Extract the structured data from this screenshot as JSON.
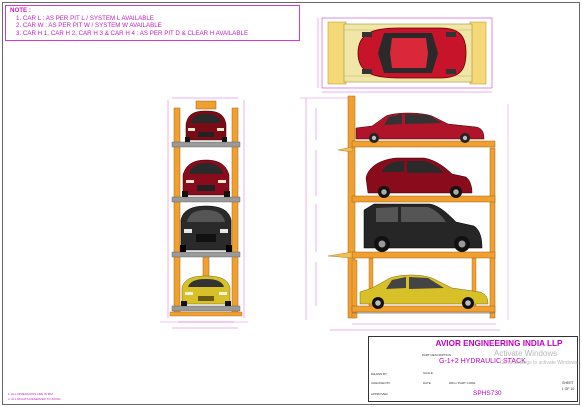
{
  "note": {
    "heading": "NOTE :",
    "lines": [
      "1. CAR L : AS PER PIT L / SYSTEM L AVAILABLE",
      "2. CAR W : AS PER PIT W / SYSTEM W AVAILABLE",
      "3. CAR H 1, CAR H 2, CAR H 3  & CAR H 4 : AS PER PIT D & CLEAR H AVAILABLE"
    ]
  },
  "title_block": {
    "company": "AVIOR ENGINEERING INDIA LLP",
    "logo_text": "AVIOR",
    "part_description_label": "PART DESCRIPTION",
    "part_description": "G-1+2 HYDRAULIC STACK",
    "drg_no_label": "DRG / PART CODE",
    "drg_no": "SPHS730",
    "sheet_label": "SHEET",
    "sheet": "1 OF 10",
    "drawn_by_label": "DRAWN BY",
    "checked_by_label": "CHECKED BY",
    "approved_label": "APPROVED",
    "scale_label": "SCALE",
    "date_label": "DATE"
  },
  "watermark": [
    "Activate Windows",
    "Go to Settings to activate Windows."
  ],
  "footnotes": [
    "1. ALL DIMENSIONS ARE IN MM",
    "2. ALL RIGHTS RESERVED TO AVIOR"
  ],
  "colors": {
    "frame": "#f0a030",
    "frame_dark": "#c87818",
    "platform": "#8a8a8a",
    "dimension": "#d040d0",
    "car_top_red": "#c8142a",
    "car_front_red": "#7a0c18",
    "car_front_dark": "#2a2a2a",
    "car_yellow": "#d8c028",
    "note_border": "#d23ad2"
  }
}
